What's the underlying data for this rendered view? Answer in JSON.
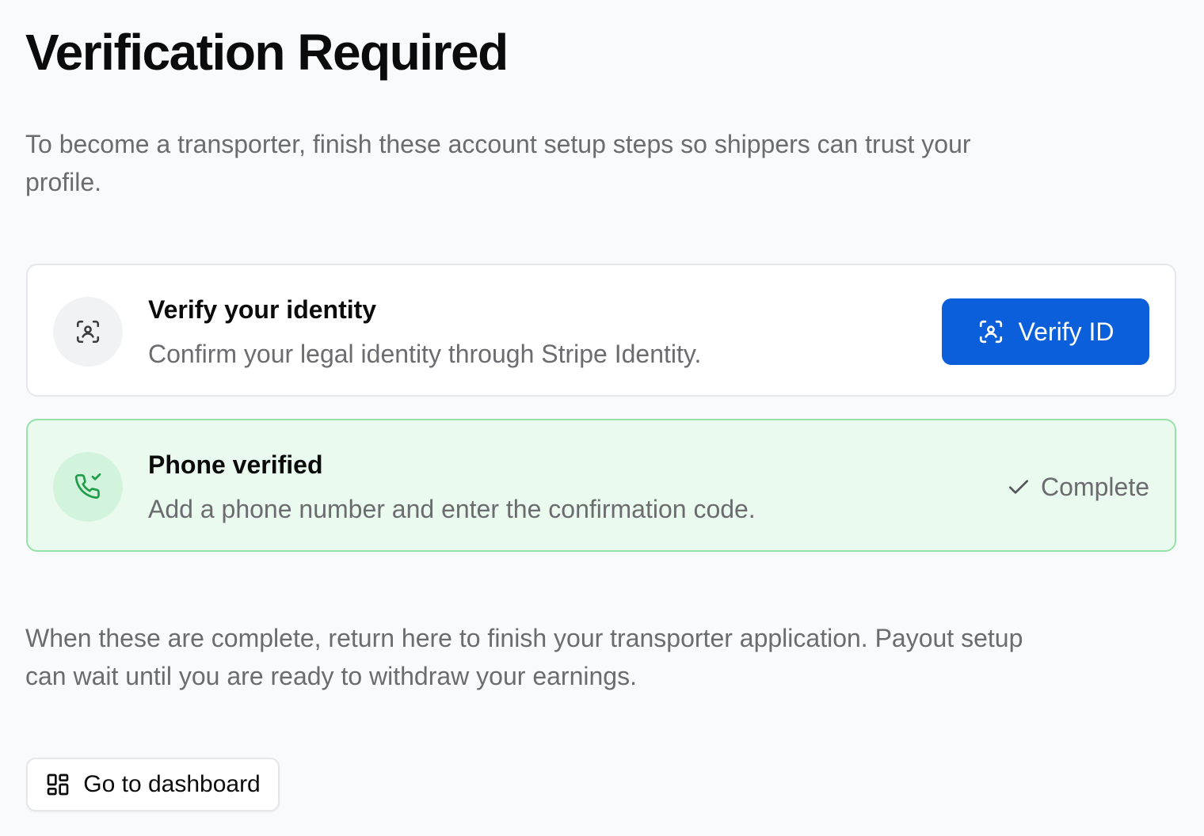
{
  "page": {
    "title": "Verification Required",
    "intro": "To become a transporter, finish these account setup steps so shippers can trust your profile.",
    "outro": "When these are complete, return here to finish your transporter application. Payout setup can wait until you are ready to withdraw your earnings."
  },
  "steps": [
    {
      "icon": "face-scan-icon",
      "title": "Verify your identity",
      "description": "Confirm your legal identity through Stripe Identity.",
      "status": "pending",
      "action_label": "Verify ID",
      "action_icon": "face-scan-icon"
    },
    {
      "icon": "phone-check-icon",
      "title": "Phone verified",
      "description": "Add a phone number and enter the confirmation code.",
      "status": "complete",
      "status_label": "Complete",
      "status_icon": "check-icon"
    }
  ],
  "footer": {
    "dashboard_label": "Go to dashboard",
    "dashboard_icon": "dashboard-grid-icon"
  },
  "colors": {
    "primary": "#0b5fda",
    "success_bg": "#eafaee",
    "success_border": "#95e2a8",
    "success_icon": "#1f9d4a",
    "text_muted": "#6b6b70",
    "page_bg": "#f9fafb"
  }
}
